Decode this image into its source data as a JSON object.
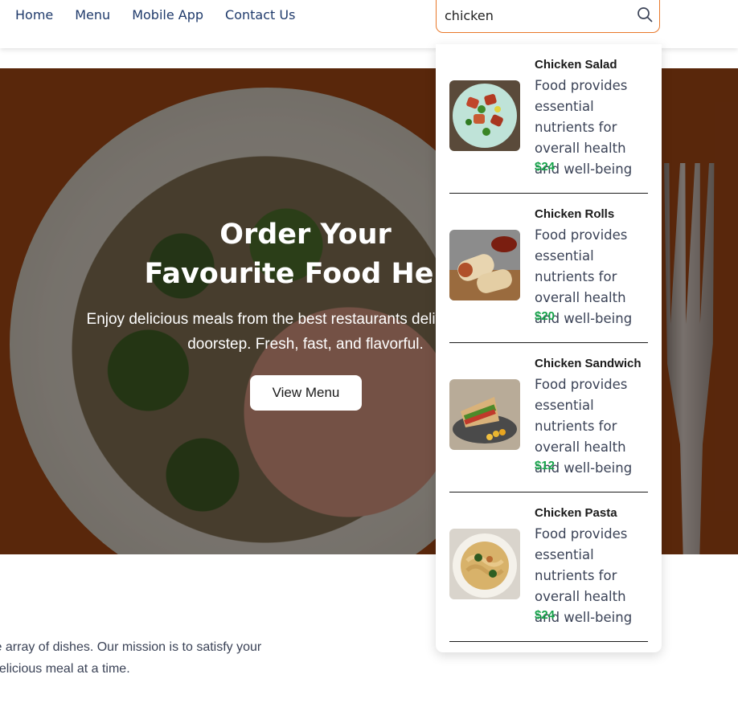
{
  "nav": {
    "links": [
      "Home",
      "Menu",
      "Mobile App",
      "Contact Us"
    ],
    "search_value": "chicken",
    "search_icon": "search-icon"
  },
  "hero": {
    "title_line1": "Order Your",
    "title_line2": "Favourite Food Here",
    "subtitle": "Enjoy delicious meals from the best restaurants delivered to your doorstep. Fresh, fast, and flavorful.",
    "button_label": "View Menu"
  },
  "about": {
    "text": "le array of dishes. Our mission is to satisfy your delicious meal at a time."
  },
  "results": [
    {
      "name": "Chicken Salad",
      "description": "Food provides essential nutrients for overall health and well-being",
      "price": "$24"
    },
    {
      "name": "Chicken Rolls",
      "description": "Food provides essential nutrients for overall health and well-being",
      "price": "$20"
    },
    {
      "name": "Chicken Sandwich",
      "description": "Food provides essential nutrients for overall health and well-being",
      "price": "$12"
    },
    {
      "name": "Chicken Pasta",
      "description": "Food provides essential nutrients for overall health and well-being",
      "price": "$24"
    }
  ],
  "colors": {
    "accent": "#e8782a",
    "price": "#16a34a",
    "hero_bg": "#9a4414"
  }
}
